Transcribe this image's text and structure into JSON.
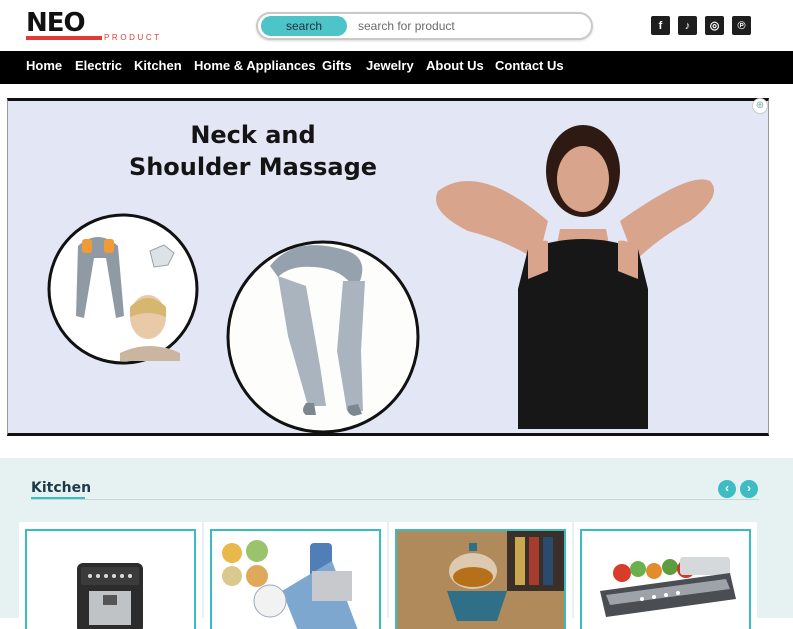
{
  "brand": {
    "name": "NEO",
    "tagline": "PRODUCT"
  },
  "search": {
    "button_label": "search",
    "placeholder": "search for product"
  },
  "socials": [
    {
      "icon": "facebook-icon",
      "glyph": "f"
    },
    {
      "icon": "tiktok-icon",
      "glyph": "♪"
    },
    {
      "icon": "instagram-icon",
      "glyph": "◎"
    },
    {
      "icon": "pinterest-icon",
      "glyph": "℗"
    }
  ],
  "nav": {
    "items": [
      "Home",
      "Electric",
      "Kitchen",
      "Home & Appliances",
      "Gifts",
      "Jewelry",
      "About Us",
      "Contact Us"
    ]
  },
  "banner": {
    "title_line1": "Neck and",
    "title_line2": "Shoulder Massage"
  },
  "kitchen": {
    "title": "Kitchen",
    "prev_icon": "‹",
    "next_icon": "›",
    "products": [
      {
        "image": "coffee-machine"
      },
      {
        "image": "vegetable-slicer"
      },
      {
        "image": "tea-set"
      },
      {
        "image": "vacuum-sealer"
      }
    ]
  },
  "colors": {
    "accent": "#3bbcc2",
    "brand_red": "#e53935",
    "nav_bg": "#000000",
    "banner_bg": "#e3e6f4"
  }
}
